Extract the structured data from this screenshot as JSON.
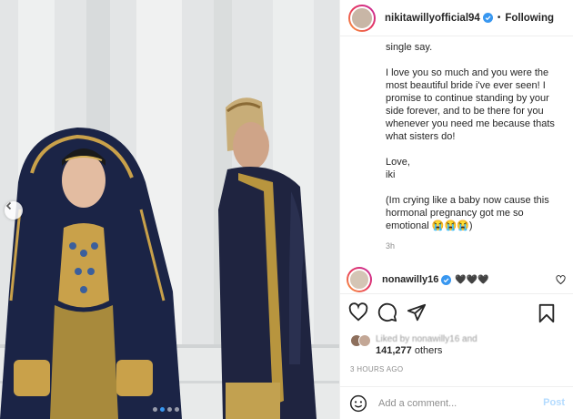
{
  "post": {
    "image_alt": "Wedding photo: bride and groom in traditional attire",
    "carousel": {
      "dot_count": 4,
      "active_index": 1
    }
  },
  "header": {
    "username": "nikitawillyofficial94",
    "follow_separator": "•",
    "follow_label": "Following"
  },
  "caption": {
    "paragraphs": [
      "single say.",
      "I love you so much and you were the most beautiful bride i've ever seen! I promise to continue standing by your side forever, and to be there for you whenever you need me because thats what sisters do!",
      "Love,\niki",
      "(Im crying like a baby now cause this hormonal pregnancy got me so emotional 😭😭😭)"
    ],
    "time": "3h"
  },
  "comment": {
    "username": "nonawilly16",
    "text": "🖤🖤🖤"
  },
  "likes": {
    "liked_by_text": "Liked by nonawilly16 and",
    "count": "141,277",
    "others_label": "others"
  },
  "time_ago": "3 HOURS AGO",
  "add_comment": {
    "placeholder": "Add a comment...",
    "post_label": "Post"
  },
  "colors": {
    "accent": "#3897f0",
    "verified": "#3897f0",
    "post_disabled": "#b3dbff",
    "story_ring": [
      "#f9a13b",
      "#e7375c",
      "#c32aa3"
    ]
  },
  "icons": [
    "chevron-left-icon",
    "verified-badge-icon",
    "heart-icon",
    "comment-icon",
    "share-icon",
    "bookmark-icon",
    "emoji-icon"
  ]
}
